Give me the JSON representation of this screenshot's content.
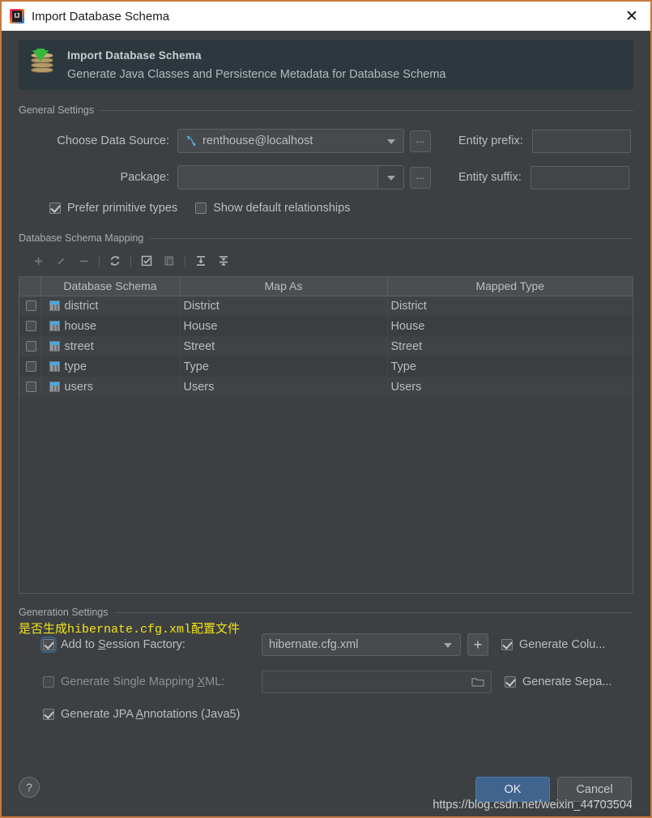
{
  "window": {
    "title": "Import Database Schema",
    "app_icon": "intellij-idea-logo",
    "close_icon": "✕"
  },
  "banner": {
    "icon": "database-import-icon",
    "title": "Import Database Schema",
    "subtitle": "Generate Java Classes and Persistence Metadata for Database Schema"
  },
  "general_settings": {
    "group_title": "General Settings",
    "data_source_label": "Choose Data Source:",
    "data_source_value": "renthouse@localhost",
    "data_source_icon": "mysql-dolphin-icon",
    "package_label": "Package:",
    "package_value": "",
    "browse_label": "...",
    "entity_prefix_label": "Entity prefix:",
    "entity_prefix_value": "",
    "entity_suffix_label": "Entity suffix:",
    "entity_suffix_value": "",
    "prefer_primitive_label": "Prefer primitive types",
    "prefer_primitive_checked": true,
    "show_default_rel_label": "Show default relationships",
    "show_default_rel_checked": false
  },
  "mapping": {
    "group_title": "Database Schema Mapping",
    "toolbar": [
      {
        "name": "add-icon",
        "glyph": "+",
        "enabled": false
      },
      {
        "name": "edit-pencil-icon",
        "glyph": "✎",
        "enabled": false
      },
      {
        "name": "remove-icon",
        "glyph": "−",
        "enabled": false
      },
      {
        "name": "refresh-icon",
        "glyph": "⟳",
        "enabled": true
      },
      {
        "name": "select-all-icon",
        "glyph": "☑",
        "enabled": true
      },
      {
        "name": "copy-icon",
        "glyph": "❐",
        "enabled": false
      },
      {
        "name": "expand-all-icon",
        "glyph": "⤓",
        "enabled": true
      },
      {
        "name": "collapse-all-icon",
        "glyph": "⤒",
        "enabled": true
      }
    ],
    "columns": [
      "",
      "Database Schema",
      "Map As",
      "Mapped Type"
    ],
    "rows": [
      {
        "checked": false,
        "schema": "district",
        "map_as": "District",
        "mapped_type": "District"
      },
      {
        "checked": false,
        "schema": "house",
        "map_as": "House",
        "mapped_type": "House"
      },
      {
        "checked": false,
        "schema": "street",
        "map_as": "Street",
        "mapped_type": "Street"
      },
      {
        "checked": false,
        "schema": "type",
        "map_as": "Type",
        "mapped_type": "Type"
      },
      {
        "checked": false,
        "schema": "users",
        "map_as": "Users",
        "mapped_type": "Users"
      }
    ]
  },
  "generation_settings": {
    "group_title": "Generation Settings",
    "annotation_note": "是否生成hibernate.cfg.xml配置文件",
    "annotation_color": "#f2e21a",
    "session_factory_label_pre": "Add to ",
    "session_factory_label_mnemonic": "S",
    "session_factory_label_post": "ession Factory:",
    "session_factory_checked": true,
    "session_factory_value": "hibernate.cfg.xml",
    "add_config_label": "+",
    "generate_columns_label": "Generate Colu...",
    "generate_columns_checked": true,
    "single_mapping_label_pre": "Generate Single Mapping ",
    "single_mapping_label_mnemonic": "X",
    "single_mapping_label_post": "ML:",
    "single_mapping_checked": false,
    "single_mapping_value": "",
    "browse_folder_icon": "folder-icon",
    "generate_separate_label": "Generate Sepa...",
    "generate_separate_checked": true,
    "jpa_label_pre": "Generate JPA ",
    "jpa_label_mnemonic": "A",
    "jpa_label_post": "nnotations (Java5)",
    "jpa_checked": true
  },
  "footer": {
    "help_label": "?",
    "ok_label": "OK",
    "cancel_label": "Cancel",
    "watermark": "https://blog.csdn.net/weixin_44703504"
  },
  "colors": {
    "dialog_bg": "#3c4043",
    "banner_bg": "#2d383e",
    "titlebar_bg": "#ffffff",
    "window_border": "#c8793c",
    "accent_blue": "#41648e",
    "note_yellow": "#f2e21a",
    "table_icon_blue": "#4aa8e0"
  }
}
